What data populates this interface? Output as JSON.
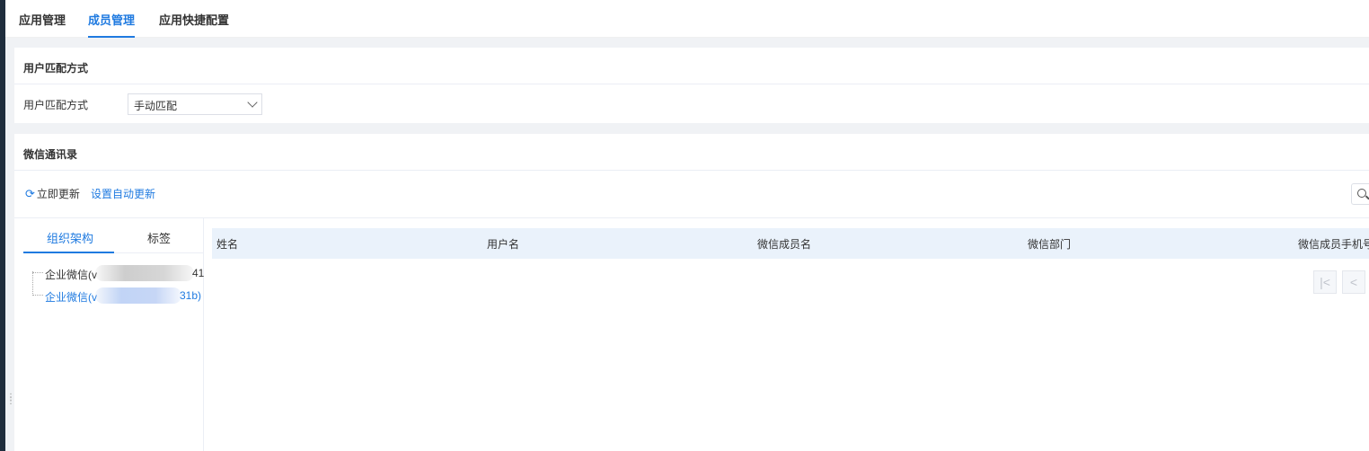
{
  "top_tabs": [
    {
      "label": "应用管理"
    },
    {
      "label": "成员管理"
    },
    {
      "label": "应用快捷配置"
    }
  ],
  "match_section": {
    "title": "用户匹配方式",
    "field_label": "用户匹配方式",
    "select_value": "手动匹配"
  },
  "contacts_section": {
    "title": "微信通讯录",
    "refresh_label": "立即更新",
    "auto_update_label": "设置自动更新",
    "tree_tabs": [
      {
        "label": "组织架构"
      },
      {
        "label": "标签"
      }
    ],
    "tree_nodes": [
      {
        "prefix": "企业微信(v",
        "suffix": "41"
      },
      {
        "prefix": "企业微信(v",
        "suffix": "31b)"
      }
    ],
    "columns": [
      "姓名",
      "用户名",
      "微信成员名",
      "微信部门",
      "微信成员手机号"
    ],
    "pager": {
      "first": "|<",
      "prev": "<"
    }
  },
  "colors": {
    "accent": "#1f7ae0",
    "header_bg": "#eaf2fb"
  }
}
